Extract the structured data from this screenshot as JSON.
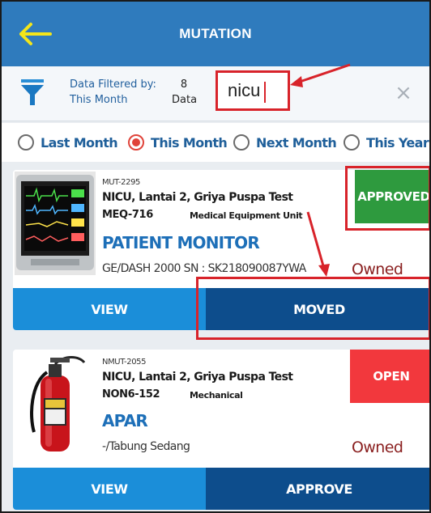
{
  "header": {
    "title": "MUTATION",
    "back_icon": "arrow-left-icon",
    "back_color": "#f3e51a",
    "bg": "#2f7bbd"
  },
  "filter": {
    "label_line1": "Data Filtered by:",
    "label_line2": "This Month",
    "count": "8",
    "count_unit": "Data",
    "search_value": "nicu",
    "clear_icon": "×"
  },
  "period": {
    "options": [
      "Last Month",
      "This Month",
      "Next Month",
      "This Year"
    ],
    "selected": "This Month"
  },
  "cards": [
    {
      "code": "MUT-2295",
      "location": "NICU, Lantai 2, Griya Puspa Test",
      "asset_no": "MEQ-716",
      "category": "Medical Equipment Unit",
      "name": "PATIENT MONITOR",
      "model": "GE/DASH 2000  SN : SK218090087YWA",
      "ownership": "Owned",
      "status": "APPROVED",
      "status_color": "#2e9a3e",
      "actions": [
        "VIEW",
        "MOVED"
      ]
    },
    {
      "code": "NMUT-2055",
      "location": "NICU, Lantai 2, Griya Puspa Test",
      "asset_no": "NON6-152",
      "category": "Mechanical",
      "name": "APAR",
      "model": "-/Tabung Sedang",
      "ownership": "Owned",
      "status": "OPEN",
      "status_color": "#f2383d",
      "actions": [
        "VIEW",
        "APPROVE"
      ]
    }
  ],
  "colors": {
    "annotation": "#d8232a",
    "action_light": "#1b8ed9",
    "action_dark": "#0d4d8c",
    "title_blue": "#1d6fb8"
  }
}
